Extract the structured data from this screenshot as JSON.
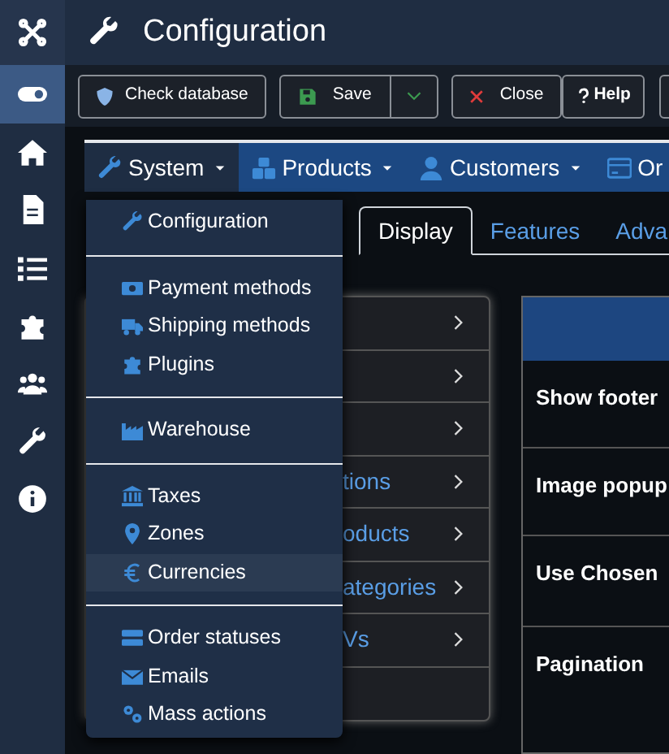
{
  "header": {
    "title": "Configuration"
  },
  "toolbar": [
    {
      "label": "Check database",
      "kind": "check"
    },
    {
      "label": "Save",
      "kind": "save"
    },
    {
      "label": "Close",
      "kind": "close"
    },
    {
      "label": "Help",
      "kind": "help"
    },
    {
      "kind": "edge"
    }
  ],
  "navbar": [
    {
      "label": "System",
      "selected": true,
      "caret": true
    },
    {
      "label": "Products",
      "selected": false,
      "caret": true
    },
    {
      "label": "Customers",
      "selected": false,
      "caret": true
    },
    {
      "label": "Or",
      "selected": false,
      "caret": false
    }
  ],
  "menu": [
    [
      {
        "label": "Configuration",
        "highlighted": false
      }
    ],
    [
      {
        "label": "Payment methods",
        "highlighted": false
      },
      {
        "label": "Shipping methods",
        "highlighted": false
      },
      {
        "label": "Plugins",
        "highlighted": false
      }
    ],
    [
      {
        "label": "Warehouse",
        "highlighted": false
      }
    ],
    [
      {
        "label": "Taxes",
        "highlighted": false
      },
      {
        "label": "Zones",
        "highlighted": false
      },
      {
        "label": "Currencies",
        "highlighted": true
      }
    ],
    [
      {
        "label": "Order statuses",
        "highlighted": false
      },
      {
        "label": "Emails",
        "highlighted": false
      },
      {
        "label": "Mass actions",
        "highlighted": false
      }
    ]
  ],
  "tabs": [
    {
      "label": "Display",
      "selected": true
    },
    {
      "label": "Features",
      "selected": false
    },
    {
      "label": "Adva",
      "selected": false
    }
  ],
  "side_list": [
    {
      "label": "tions"
    },
    {
      "label": "oducts"
    },
    {
      "label": "ategories"
    },
    {
      "label": "Vs"
    }
  ],
  "settings": [
    {
      "label": "Show footer"
    },
    {
      "label": "Image popup"
    },
    {
      "label": "Use Chosen"
    },
    {
      "label": "Pagination"
    }
  ]
}
